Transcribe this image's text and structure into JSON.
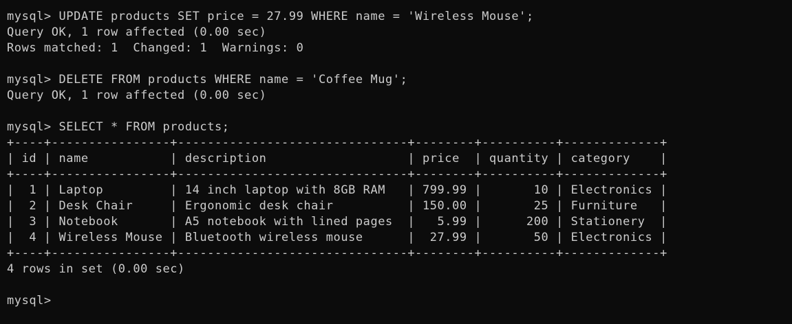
{
  "terminal": {
    "lines": [
      "mysql> UPDATE products SET price = 27.99 WHERE name = 'Wireless Mouse';",
      "Query OK, 1 row affected (0.00 sec)",
      "Rows matched: 1  Changed: 1  Warnings: 0",
      "",
      "mysql> DELETE FROM products WHERE name = 'Coffee Mug';",
      "Query OK, 1 row affected (0.00 sec)",
      "",
      "mysql> SELECT * FROM products;",
      "+----+----------------+-------------------------------+--------+----------+-------------+",
      "| id | name           | description                   | price  | quantity | category    |",
      "+----+----------------+-------------------------------+--------+----------+-------------+",
      "|  1 | Laptop         | 14 inch laptop with 8GB RAM   | 799.99 |       10 | Electronics |",
      "|  2 | Desk Chair     | Ergonomic desk chair          | 150.00 |       25 | Furniture   |",
      "|  3 | Notebook       | A5 notebook with lined pages  |   5.99 |      200 | Stationery  |",
      "|  4 | Wireless Mouse | Bluetooth wireless mouse      |  27.99 |       50 | Electronics |",
      "+----+----------------+-------------------------------+--------+----------+-------------+",
      "4 rows in set (0.00 sec)",
      "",
      "mysql> "
    ]
  }
}
